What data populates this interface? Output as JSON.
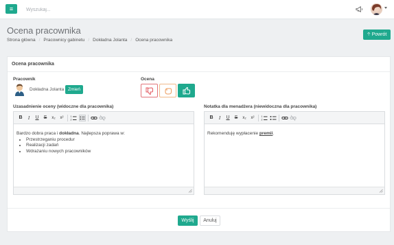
{
  "topbar": {
    "search_placeholder": "Wyszukaj...",
    "menu_icon": "hamburger-icon",
    "notification_icon": "megaphone-icon"
  },
  "page": {
    "title": "Ocena pracownika",
    "back_label": "Powrót"
  },
  "breadcrumb": [
    "Strona główna",
    "Pracownicy gabinetu",
    "Dokładna Jolanta",
    "Ocena pracownika"
  ],
  "card": {
    "title": "Ocena pracownika",
    "employee_label": "Pracownik",
    "employee_name": "Dokładna Jolanta",
    "change_label": "Zmień",
    "rating_label": "Ocena",
    "rating_options": [
      "thumbs-down-icon",
      "neutral-hand-icon",
      "thumbs-up-icon"
    ],
    "rating_selected": "thumbs-up-icon"
  },
  "editor_left": {
    "label": "Uzasadnienie oceny (widoczne dla pracownika)",
    "text_before": "Bardzo dobra praca i ",
    "text_bold": "dokładna",
    "text_after": ". Najlepsza poprawa w:",
    "items": [
      "Przestrzeganiu procedur",
      "Realizacji zadań",
      "Wdrażaniu nowych pracowników"
    ]
  },
  "editor_right": {
    "label": "Notatka dla menadżera (niewidoczna dla pracownika)",
    "text_before": "Rekomenduję wypłacenie ",
    "text_bold": "premii",
    "text_after": "."
  },
  "toolbar_buttons": [
    "B",
    "I",
    "U",
    "S",
    "x₂",
    "x²"
  ],
  "actions": {
    "submit_label": "Wyślij",
    "cancel_label": "Anuluj"
  },
  "colors": {
    "accent": "#1fa98e",
    "negative": "#e2747a",
    "neutral": "#f0b98a"
  }
}
